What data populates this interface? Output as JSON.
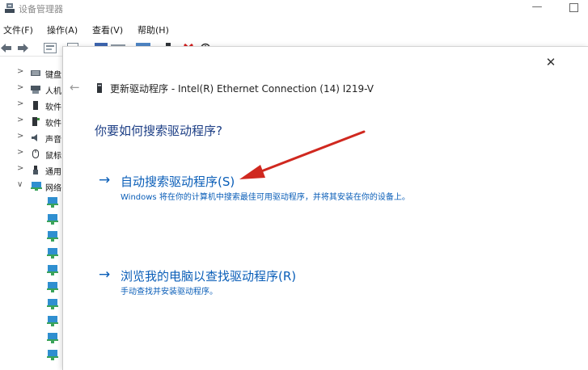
{
  "window": {
    "title": "设备管理器",
    "minimize_glyph": "—"
  },
  "menu": {
    "items": [
      "文件(F)",
      "操作(A)",
      "查看(V)",
      "帮助(H)"
    ]
  },
  "tree": {
    "nodes": [
      {
        "expander": ">",
        "label": "键盘",
        "icon": "keyboard-icon"
      },
      {
        "expander": ">",
        "label": "人机",
        "icon": "human-interface-icon"
      },
      {
        "expander": ">",
        "label": "软件",
        "icon": "software-component-icon"
      },
      {
        "expander": ">",
        "label": "软件",
        "icon": "software-device-icon"
      },
      {
        "expander": ">",
        "label": "声音",
        "icon": "speaker-icon"
      },
      {
        "expander": ">",
        "label": "鼠标",
        "icon": "mouse-icon"
      },
      {
        "expander": ">",
        "label": "通用",
        "icon": "usb-icon"
      },
      {
        "expander": "∨",
        "label": "网络",
        "icon": "network-adapter-icon"
      }
    ]
  },
  "dialog": {
    "close_glyph": "✕",
    "back_glyph": "←",
    "title": "更新驱动程序 - Intel(R) Ethernet Connection (14) I219-V",
    "question": "你要如何搜索驱动程序?",
    "option_arrow": "→",
    "auto_search": {
      "label": "自动搜索驱动程序(S)",
      "description": "Windows 将在你的计算机中搜索最佳可用驱动程序，并将其安装在你的设备上。"
    },
    "browse": {
      "label": "浏览我的电脑以查找驱动程序(R)",
      "description": "手动查找并安装驱动程序。"
    }
  },
  "colors": {
    "link": "#0a5eb8",
    "question": "#1c3e85",
    "annotation_arrow": "#d0281f"
  }
}
